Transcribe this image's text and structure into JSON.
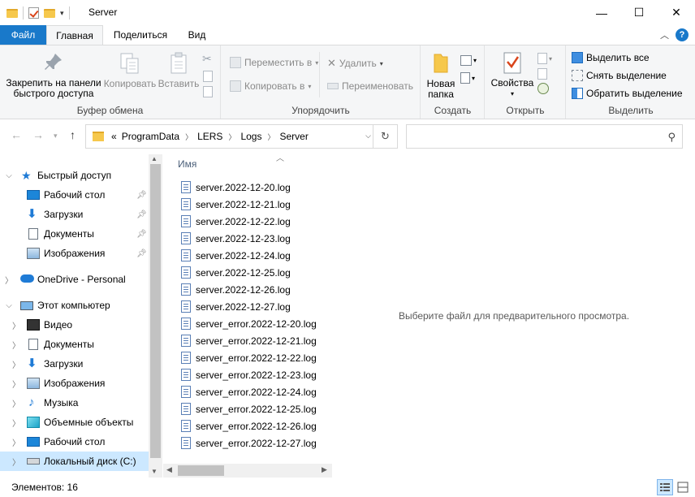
{
  "window": {
    "title": "Server",
    "controls": {
      "minimize": "—",
      "maximize": "☐",
      "close": "✕"
    }
  },
  "ribbon_tabs": [
    "Файл",
    "Главная",
    "Поделиться",
    "Вид"
  ],
  "ribbon": {
    "clipboard": {
      "label": "Буфер обмена",
      "pin": "Закрепить на панели быстрого доступа",
      "pin_line1": "Закрепить на панели",
      "pin_line2": "быстрого доступа",
      "copy": "Копировать",
      "paste": "Вставить"
    },
    "organize": {
      "label": "Упорядочить",
      "move_to": "Переместить в",
      "copy_to": "Копировать в",
      "delete": "Удалить",
      "rename": "Переименовать"
    },
    "new": {
      "label": "Создать",
      "new_folder_line1": "Новая",
      "new_folder_line2": "папка"
    },
    "open": {
      "label": "Открыть",
      "properties": "Свойства"
    },
    "select": {
      "label": "Выделить",
      "select_all": "Выделить все",
      "select_none": "Снять выделение",
      "invert": "Обратить выделение"
    }
  },
  "address": {
    "breadcrumbs": [
      "ProgramData",
      "LERS",
      "Logs",
      "Server"
    ],
    "overflow": "«"
  },
  "nav": {
    "quick_access": "Быстрый доступ",
    "quick_items": [
      "Рабочий стол",
      "Загрузки",
      "Документы",
      "Изображения"
    ],
    "onedrive": "OneDrive - Personal",
    "this_pc": "Этот компьютер",
    "pc_items": [
      "Видео",
      "Документы",
      "Загрузки",
      "Изображения",
      "Музыка",
      "Объемные объекты",
      "Рабочий стол",
      "Локальный диск (C:)"
    ]
  },
  "filelist": {
    "column": "Имя",
    "files": [
      "server.2022-12-20.log",
      "server.2022-12-21.log",
      "server.2022-12-22.log",
      "server.2022-12-23.log",
      "server.2022-12-24.log",
      "server.2022-12-25.log",
      "server.2022-12-26.log",
      "server.2022-12-27.log",
      "server_error.2022-12-20.log",
      "server_error.2022-12-21.log",
      "server_error.2022-12-22.log",
      "server_error.2022-12-23.log",
      "server_error.2022-12-24.log",
      "server_error.2022-12-25.log",
      "server_error.2022-12-26.log",
      "server_error.2022-12-27.log"
    ]
  },
  "preview": {
    "message": "Выберите файл для предварительного просмотра."
  },
  "status": {
    "items_count": "Элементов: 16"
  }
}
